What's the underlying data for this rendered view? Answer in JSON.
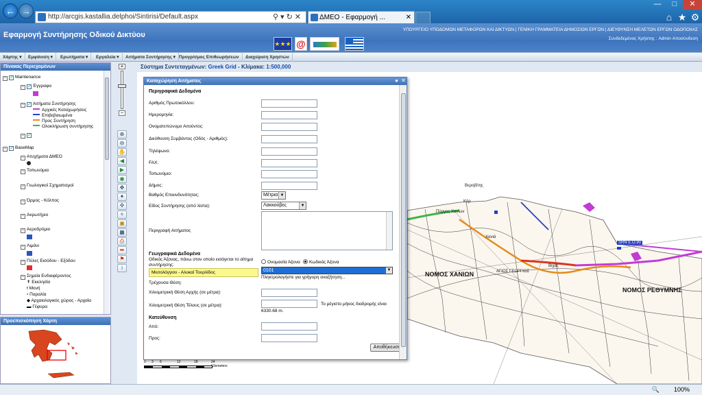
{
  "browser": {
    "url": "http://arcgis.kastallia.delphoi/Sintirisi/Default.aspx",
    "tab_title": "ΔΜΕΟ - Εφαρμογή ...",
    "zoom": "100%"
  },
  "header": {
    "title": "Εφαρμογή Συντήρησης Οδικού Δικτύου",
    "ministry_line": "ΥΠΟΥΡΓΕΙΟ ΥΠΟΔΟΜΩΝ ΜΕΤΑΦΟΡΩΝ ΚΑΙ ΔΙΚΤΥΩΝ  |  ΓΕΝΙΚΗ ΓΡΑΜΜΑΤΕΙΑ ΔΗΜΟΣΙΩΝ ΕΡΓΩΝ  |  ΔΙΕΥΘΥΝΣΗ ΜΕΛΕΤΩΝ ΕΡΓΩΝ ΟΔΟΠΟΙΙΑΣ",
    "user_line": "Συνδεδεμένος Χρήστης : Admin   Αποσύνδεση"
  },
  "menu": [
    "Χάρτης ▾",
    "Εμφάνιση ▾",
    "Ερωτήματα ▾",
    "Εργαλεία ▾",
    "Αιτήματα Συντήρησης ▾",
    "Προγρ/σμος Επιθεωρήσεων",
    "Διαχείριση Χρηστών"
  ],
  "layers_panel": {
    "title": "Πίνακας Περιεχομένων",
    "maintenance": "Maintenance",
    "documents": "Έγγραφα",
    "requests": "Αιτήματα Συντήρησης",
    "legend": [
      {
        "label": "Αρχικές Καταχωρήσεις",
        "color": "#c23bd4"
      },
      {
        "label": "Επιβεβαιωμένα",
        "color": "#2140c8"
      },
      {
        "label": "Προς Συντήρηση",
        "color": "#e58b1a"
      },
      {
        "label": "Ολοκλήρωση συντήρησης",
        "color": "#39b54a"
      }
    ],
    "basemap": "BaseMap",
    "basemap_layers": [
      "Ατυχήματα ΔΜΕΟ",
      "Τοπωνύμια",
      "Γεωλογικοί Σχηματισμοί",
      "Όρμος - Κόλπος",
      "Ακρωτήριο",
      "Αεροδρόμιο",
      "Λιμάνι",
      "Πύλες Εισόδου - Εξόδου",
      "Σημεία Ενδιαφέροντος"
    ],
    "poi": [
      "Εκκλησία",
      "Μονή",
      "Παραλία",
      "Αρχαιολογικός χώρος - Αρχαία",
      "Γέφυρα"
    ]
  },
  "overview": {
    "title": "Προεπισκόπηση Χάρτη"
  },
  "map": {
    "coord_label": "Σύστημα Συντεταγμένων:",
    "coord_value": "Greek Grid",
    "scale_label": "- Κλίμακα:",
    "scale_value": "1:500,000",
    "places": [
      "Βεροβίτης",
      "Κόρ",
      "Πύργος Χανίων",
      "Χανιά",
      "ΝΟΜΟΣ ΧΑΝΙΩΝ",
      "ΝΟΜΟΣ ΡΕΘΥΜΝΗΣ",
      "SRN E.O.90",
      "Βιχάς",
      "ΑΓΙΟΣ ΓΕΩΡΓΙΟΣ"
    ],
    "scale_ticks": [
      "0",
      "3",
      "6",
      "12",
      "18",
      "24 Kilometers"
    ]
  },
  "dialog": {
    "title": "Καταχώρηση Αιτήματος",
    "section_desc": "Περιγραφικά Δεδομένα",
    "fields": [
      "Αριθμός Πρωτοκόλλου:",
      "Ημερομηνία:",
      "Ονοματεπώνυμο Αιτούντος:",
      "Διεύθυνση Συμβάντος (Οδός - Αριθμός):",
      "Τηλέφωνο:",
      "FAX:",
      "Τοπωνύμιο:",
      "Δήμος:"
    ],
    "urgency_label": "Βαθμός Επικινδυνότητας:",
    "urgency_value": "Μέτρια",
    "type_label": "Είδος Συντήρησης (από λίστα):",
    "type_value": "Λακκούβες",
    "description_label": "Περιγραφή Αιτήματος",
    "section_geo": "Γεωγραφικά Δεδομένα",
    "axis_label": "Οδικός Άξονας, πάνω στον οποίο εισάγεται το αίτημα συντήρησης:",
    "radio_name": "Ονομασία Άξονα",
    "radio_code": "Κωδικός Άξονα",
    "axis_name_value": "Μεσολόγγιον - Αλυκαί Τουρλίδος",
    "axis_code_value": "0101",
    "hint": "Πληκτρολογήστε για γρήγορη αναζήτηση...",
    "current_pos_label": "Τρέχουσα Θέση:",
    "start_label": "Χιλιομετρική Θέση Αρχής (σε μέτρα):",
    "end_label": "Χιλιομετρική Θέση Τέλους (σε μέτρα):",
    "max_length_note": "Το μέγιστο μήκος διαδρομής είναι",
    "max_length_value": "6330.68 m.",
    "direction_section": "Κατεύθυνση",
    "from_label": "Από:",
    "to_label": "Προς:",
    "save_label": "Αποθήκευση"
  }
}
